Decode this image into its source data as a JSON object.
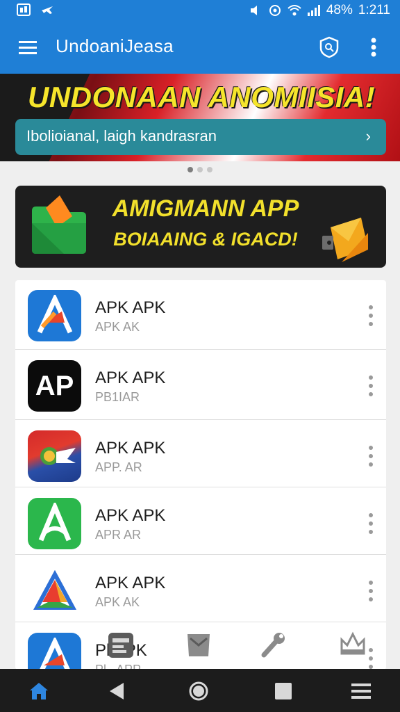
{
  "status_bar": {
    "battery": "48%",
    "time": "1:211",
    "icons": [
      "gallery-icon",
      "plane-icon",
      "sound-icon",
      "eye-comfort-icon",
      "wifi-icon",
      "signal-icon"
    ]
  },
  "app_bar": {
    "title": "UndoaniJeasa",
    "icons": [
      "menu-icon",
      "search-shield-icon",
      "more-vertical-icon"
    ]
  },
  "hero_banner": {
    "headline": "UNDONAAN ANOMIISIA!",
    "search_text": "Ibolioianal, laigh kandrasran",
    "chevron": "›",
    "page_count": 3,
    "active_page": 0
  },
  "promo_banner": {
    "line1": "AMIGMANN APP",
    "line2": "BOIAAING & IGACD!"
  },
  "app_list": [
    {
      "title": "APK APK",
      "subtitle": "APK AK",
      "icon": "blue-a-app-icon"
    },
    {
      "title": "APK APK",
      "subtitle": "PB1IAR",
      "icon": "black-ap-app-icon"
    },
    {
      "title": "APK APK",
      "subtitle": "APP. AR",
      "icon": "red-blue-app-icon"
    },
    {
      "title": "APK APK",
      "subtitle": "APR AR",
      "icon": "green-a-app-icon"
    },
    {
      "title": "APK APK",
      "subtitle": "APK AK",
      "icon": "triangle-a-app-icon"
    },
    {
      "title": "Pl APK",
      "subtitle": "Pl.. APP",
      "icon": "blue-a-app-icon-2"
    }
  ],
  "colors": {
    "primary": "#1f7fd6",
    "headline_yellow": "#f6e52b",
    "search_teal": "#2a8a99",
    "nav_bg": "#1c1c1c"
  },
  "bottom_overlay_icons": [
    "card-icon",
    "tray-icon",
    "wrench-icon",
    "crown-icon"
  ],
  "nav_bar": [
    "home-icon",
    "back-icon",
    "home-circle-icon",
    "recents-icon",
    "menu-lines-icon"
  ]
}
